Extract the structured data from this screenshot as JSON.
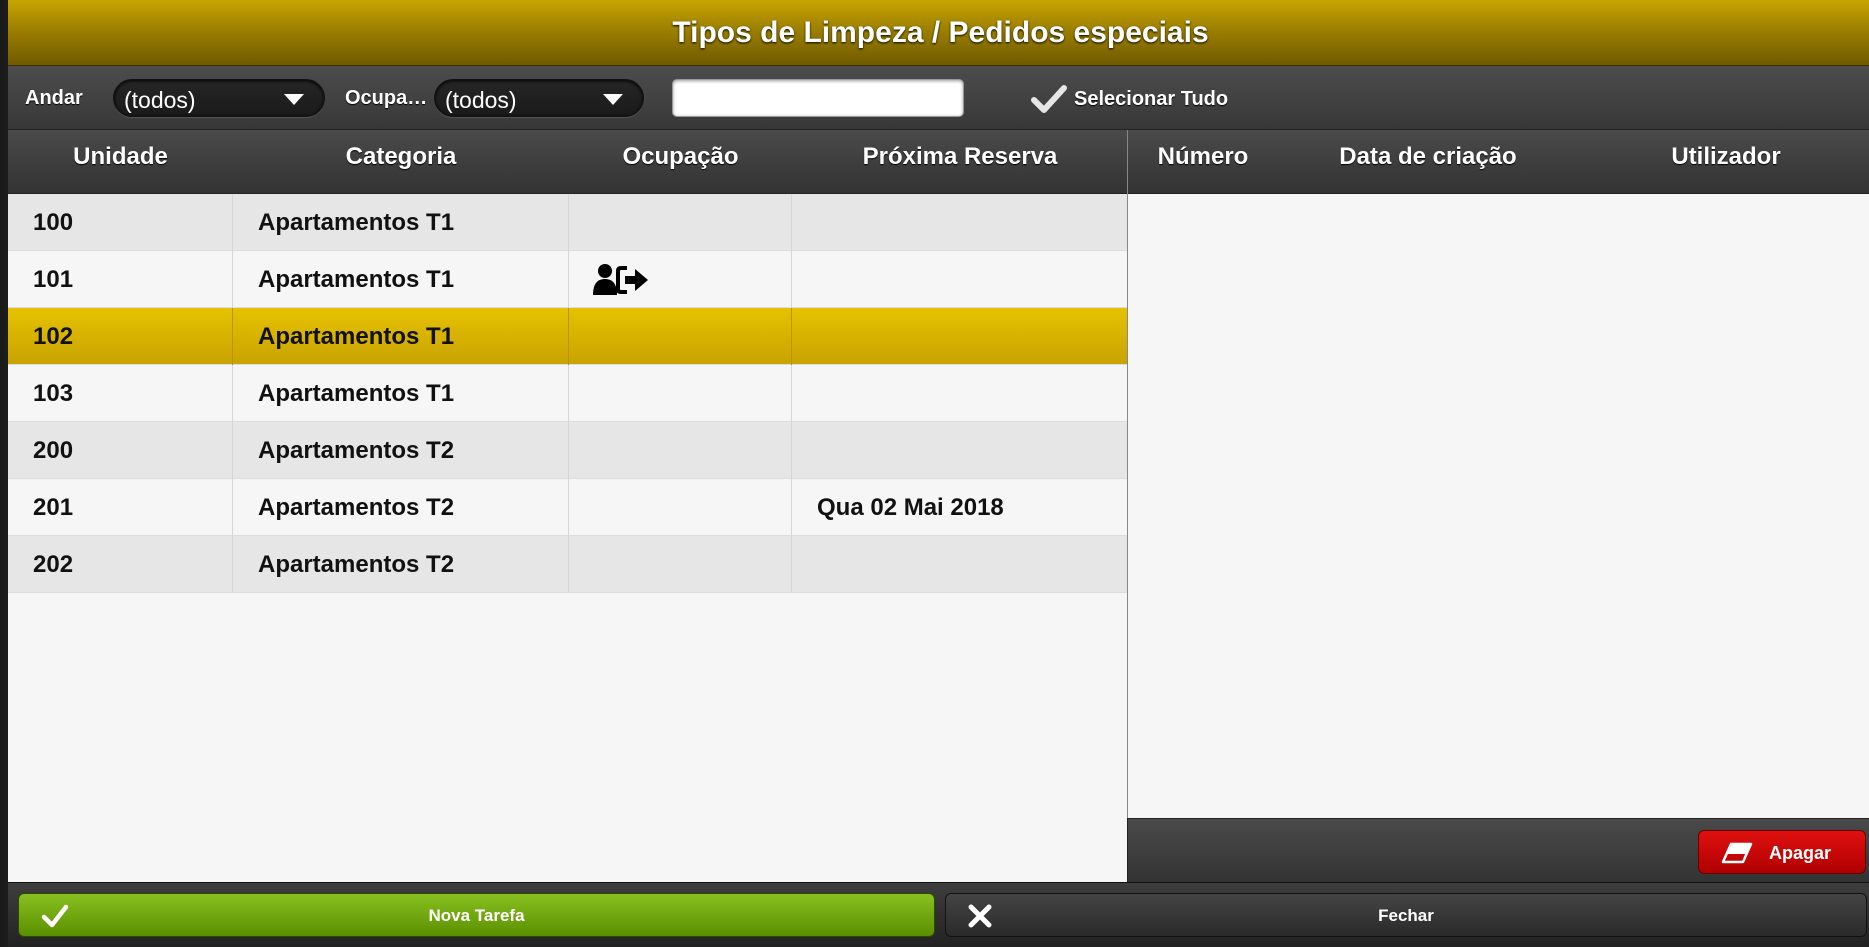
{
  "window": {
    "title": "Tipos de Limpeza / Pedidos especiais"
  },
  "filters": {
    "andar_label": "Andar",
    "andar_value": "(todos)",
    "ocupa_label": "Ocupa…",
    "ocupa_value": "(todos)",
    "search_value": "",
    "select_all_label": "Selecionar Tudo"
  },
  "units_table": {
    "columns": [
      "Unidade",
      "Categoria",
      "Ocupação",
      "Próxima Reserva"
    ],
    "rows": [
      {
        "unidade": "100",
        "categoria": "Apartamentos T1",
        "ocupacao": "",
        "proxima": ""
      },
      {
        "unidade": "101",
        "categoria": "Apartamentos T1",
        "ocupacao": "checkout-icon",
        "proxima": ""
      },
      {
        "unidade": "102",
        "categoria": "Apartamentos T1",
        "ocupacao": "",
        "proxima": "",
        "selected": true
      },
      {
        "unidade": "103",
        "categoria": "Apartamentos T1",
        "ocupacao": "",
        "proxima": ""
      },
      {
        "unidade": "200",
        "categoria": "Apartamentos T2",
        "ocupacao": "",
        "proxima": ""
      },
      {
        "unidade": "201",
        "categoria": "Apartamentos T2",
        "ocupacao": "",
        "proxima": "Qua 02 Mai 2018"
      },
      {
        "unidade": "202",
        "categoria": "Apartamentos T2",
        "ocupacao": "",
        "proxima": ""
      }
    ]
  },
  "requests_table": {
    "columns": [
      "Número",
      "Data de criação",
      "Utilizador"
    ],
    "rows": []
  },
  "buttons": {
    "apagar": "Apagar",
    "nova_tarefa": "Nova Tarefa",
    "fechar": "Fechar"
  },
  "colors": {
    "title_gold": "#9d8000",
    "selected_row": "#d9b400",
    "delete_red": "#c80000",
    "confirm_green": "#6fa810"
  }
}
